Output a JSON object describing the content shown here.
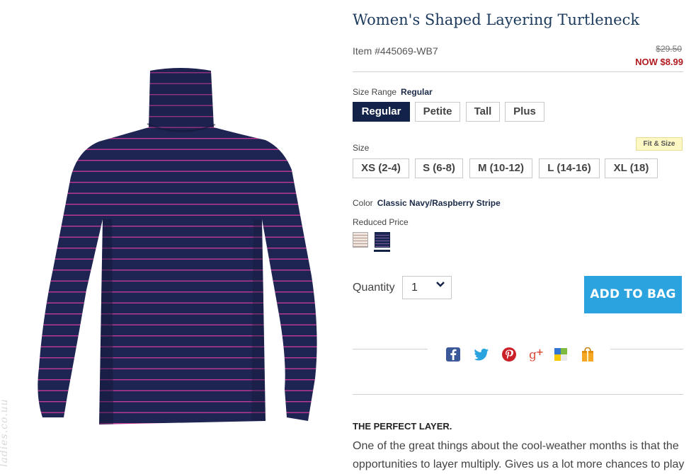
{
  "product": {
    "title": "Women's Shaped Layering Turtleneck",
    "item_number": "Item #445069-WB7",
    "original_price": "$29.50",
    "sale_price": "NOW $8.99"
  },
  "size_range": {
    "label": "Size Range",
    "selected": "Regular",
    "options": [
      "Regular",
      "Petite",
      "Tall",
      "Plus"
    ]
  },
  "size": {
    "label": "Size",
    "fit_link": "Fit & Size",
    "options": [
      "XS (2-4)",
      "S (6-8)",
      "M (10-12)",
      "L (14-16)",
      "XL (18)"
    ]
  },
  "color": {
    "label": "Color",
    "selected": "Classic Navy/Raspberry Stripe",
    "group_label": "Reduced Price",
    "swatches": [
      "pink-stripe-swatch",
      "navy-stripe-swatch"
    ]
  },
  "quantity": {
    "label": "Quantity",
    "value": "1"
  },
  "cta": {
    "add_to_bag": "ADD TO BAG"
  },
  "share_icons": [
    "facebook-icon",
    "twitter-icon",
    "pinterest-icon",
    "google-plus-icon",
    "delicious-icon",
    "gift-bag-icon"
  ],
  "description": {
    "heading": "THE PERFECT LAYER.",
    "text": "One of the great things about the cool-weather months is that the opportunities to layer multiply. Gives us a lot more chances to play"
  },
  "watermark": "ladies.co.uu",
  "colors": {
    "navy": "#132248",
    "price_red": "#b01c20",
    "cta_blue": "#2aa3de",
    "title_blue": "#1b3a5c",
    "stripe_pink": "#d43c9a"
  }
}
